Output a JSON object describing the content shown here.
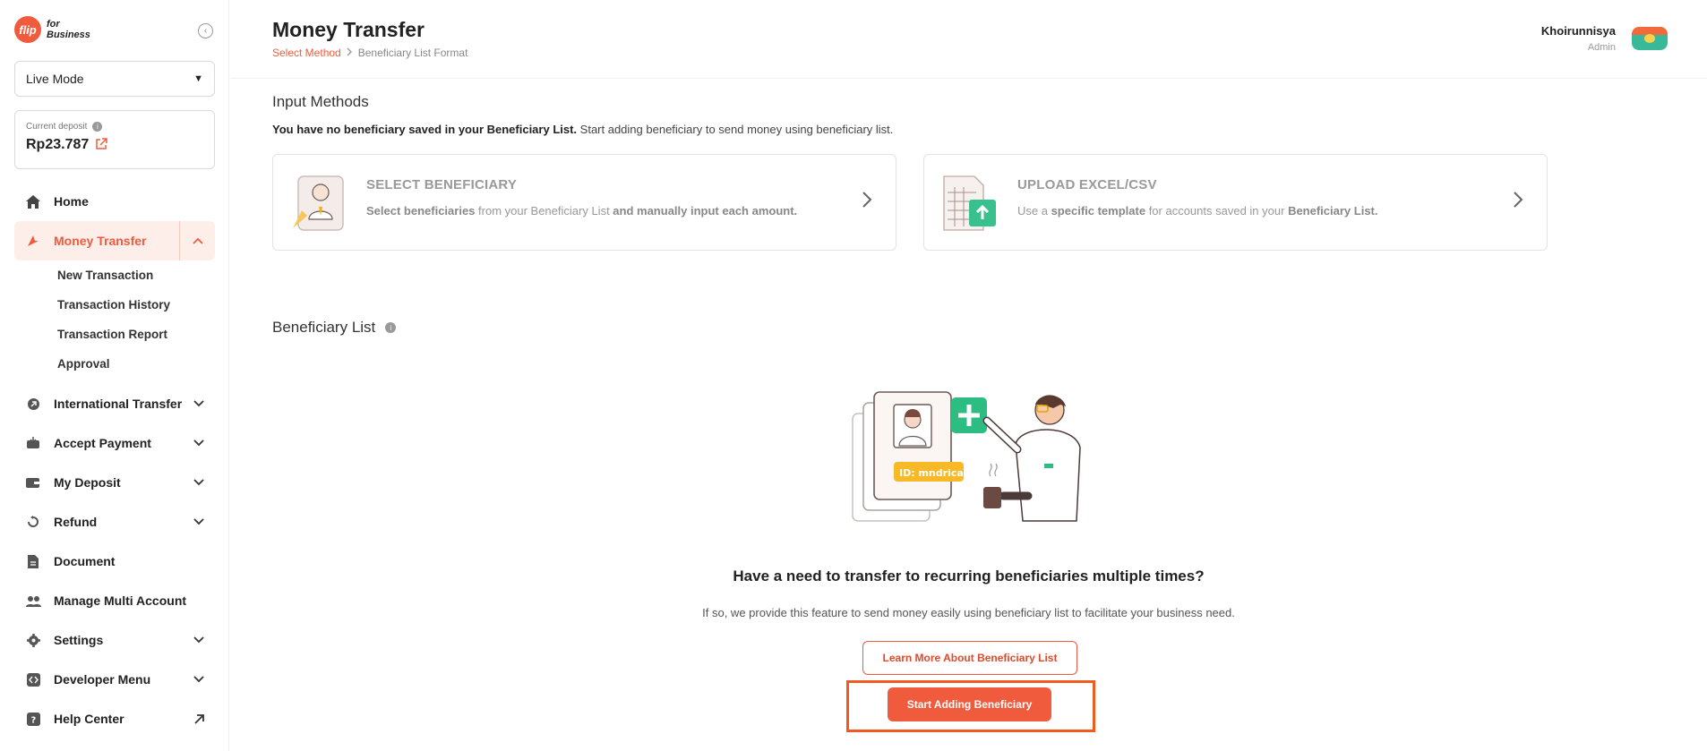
{
  "sidebar": {
    "logo_mark": "flip",
    "logo_line1": "for",
    "logo_line2": "Business",
    "mode_select": "Live Mode",
    "deposit_label": "Current deposit",
    "deposit_amount": "Rp23.787",
    "nav": [
      {
        "label": "Home",
        "icon": "home-icon"
      },
      {
        "label": "Money Transfer",
        "icon": "transfer-icon",
        "active": true
      },
      {
        "label": "International Transfer",
        "icon": "globe-transfer-icon"
      },
      {
        "label": "Accept Payment",
        "icon": "payment-icon"
      },
      {
        "label": "My Deposit",
        "icon": "wallet-icon"
      },
      {
        "label": "Refund",
        "icon": "refund-icon"
      },
      {
        "label": "Document",
        "icon": "document-icon"
      },
      {
        "label": "Manage Multi Account",
        "icon": "users-icon"
      },
      {
        "label": "Settings",
        "icon": "gear-icon"
      },
      {
        "label": "Developer Menu",
        "icon": "code-icon"
      },
      {
        "label": "Help Center",
        "icon": "help-icon"
      }
    ],
    "sub_items": [
      "New Transaction",
      "Transaction History",
      "Transaction Report",
      "Approval"
    ]
  },
  "header": {
    "title": "Money Transfer",
    "breadcrumb_active": "Select Method",
    "breadcrumb_next": "Beneficiary List Format",
    "user_name": "Khoirunnisya",
    "user_role": "Admin"
  },
  "main": {
    "input_methods_title": "Input Methods",
    "info_bold": "You have no beneficiary saved in your Beneficiary List.",
    "info_rest": " Start adding beneficiary to send money using beneficiary list.",
    "cards": [
      {
        "title": "SELECT BENEFICIARY",
        "desc_b1": "Select beneficiaries",
        "desc_t1": " from your Beneficiary List ",
        "desc_b2": "and manually input each amount.",
        "desc_t2": ""
      },
      {
        "title": "UPLOAD EXCEL/CSV",
        "desc_t0": "Use a ",
        "desc_b1": "specific template",
        "desc_t1": " for accounts saved in your ",
        "desc_b2": "Beneficiary List.",
        "desc_t2": ""
      }
    ],
    "beneficiary_title": "Beneficiary List",
    "illus_id_badge": "ID: mndrica",
    "empty_title": "Have a need to transfer to recurring beneficiaries multiple times?",
    "empty_desc": "If so, we provide this feature to send money easily using beneficiary list to facilitate your business need.",
    "learn_more": "Learn More About Beneficiary List",
    "start_adding": "Start Adding Beneficiary"
  },
  "colors": {
    "accent": "#f15b3d",
    "highlight_border": "#f05a1e"
  }
}
